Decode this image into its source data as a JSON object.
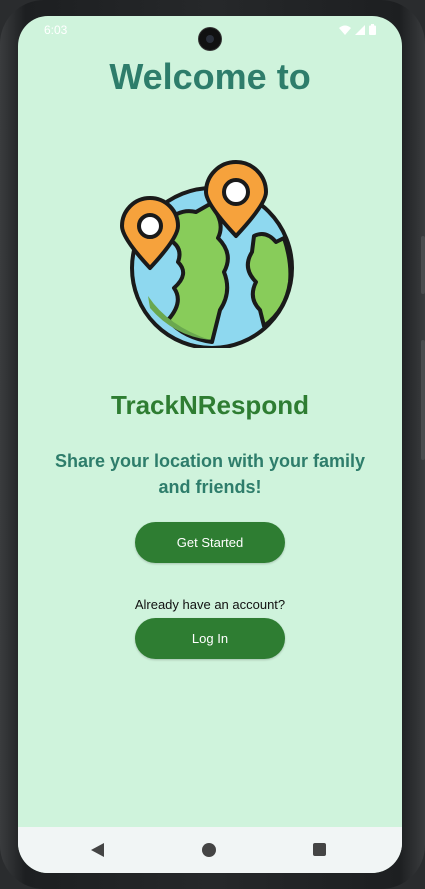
{
  "status_bar": {
    "time": "6:03",
    "icons": [
      "wifi-icon",
      "signal-icon",
      "battery-icon"
    ]
  },
  "main": {
    "welcome_title": "Welcome to",
    "app_name": "TrackNRespond",
    "tagline": "Share your location with your family and friends!",
    "get_started_label": "Get Started",
    "account_prompt": "Already have an account?",
    "login_label": "Log In"
  },
  "logo": {
    "icon": "globe-with-location-pins-icon"
  },
  "navigation": {
    "back": "back-icon",
    "home": "home-icon",
    "recents": "recents-icon"
  },
  "colors": {
    "screen_background": "#cff3dc",
    "title": "#2e7d6b",
    "app_name": "#2e7d32",
    "button": "#2e7d32",
    "button_text": "#ffffff",
    "pin": "#f6a23c",
    "ocean": "#8ed8ef",
    "land": "#88cc5a"
  }
}
